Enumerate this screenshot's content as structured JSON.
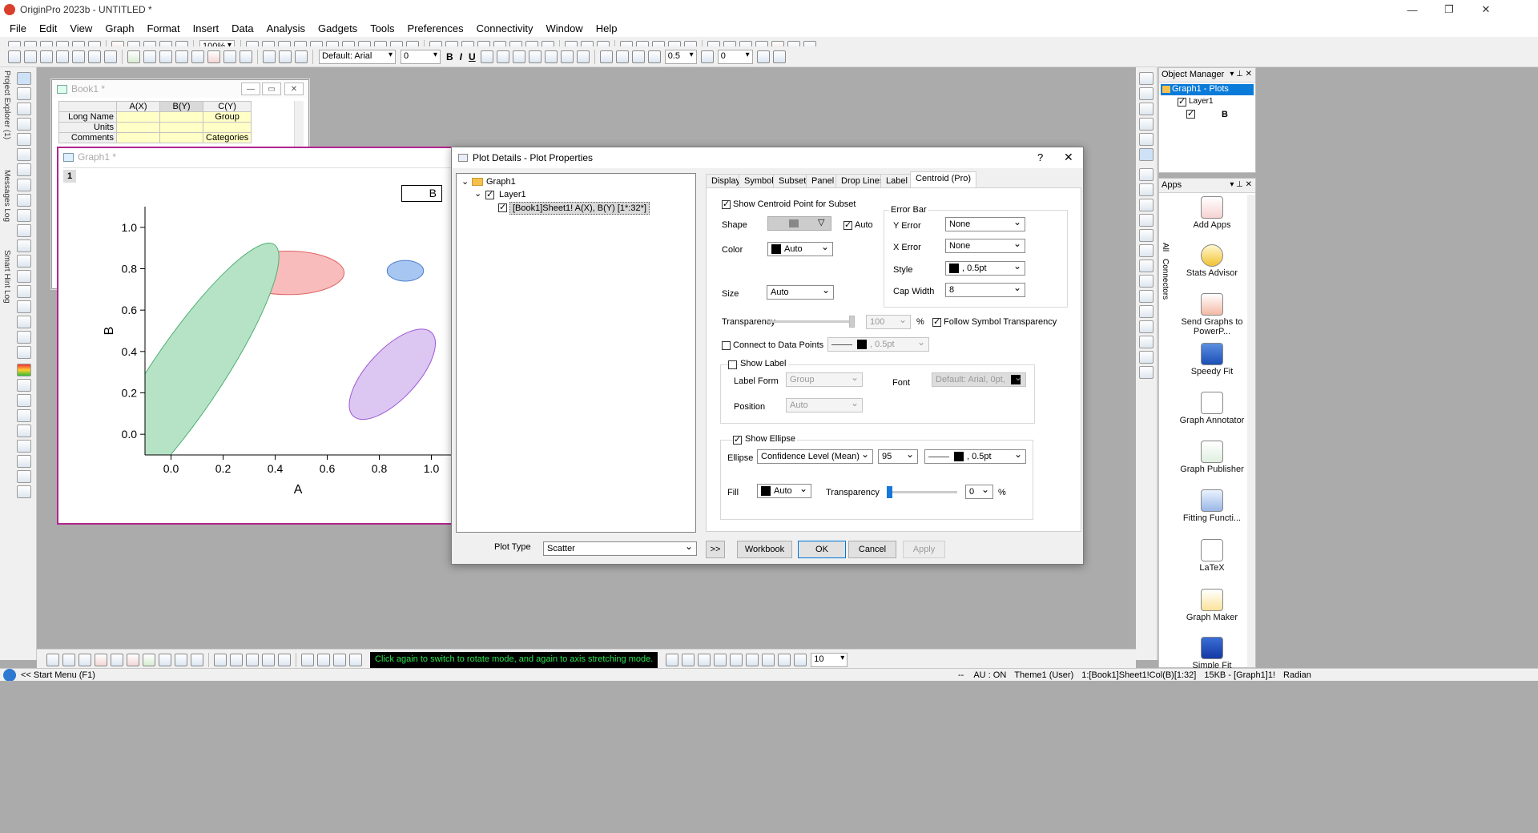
{
  "window": {
    "title": "OriginPro 2023b - UNTITLED *"
  },
  "menu": [
    "File",
    "Edit",
    "View",
    "Graph",
    "Format",
    "Insert",
    "Data",
    "Analysis",
    "Gadgets",
    "Tools",
    "Preferences",
    "Connectivity",
    "Window",
    "Help"
  ],
  "toolbar": {
    "zoom": "100%",
    "font": "Default: Arial",
    "font_size": "0",
    "line_width": "0.5",
    "pattern_size": "0"
  },
  "left_dock": {
    "tabs": [
      "Project Explorer (1)",
      "Messages Log",
      "Smart Hint Log"
    ]
  },
  "book1": {
    "title": "Book1 *",
    "columns": [
      "A(X)",
      "B(Y)",
      "C(Y)"
    ],
    "rows": [
      {
        "label": "Long Name",
        "c": "Group"
      },
      {
        "label": "Units",
        "c": ""
      },
      {
        "label": "Comments",
        "c": "Categories"
      }
    ]
  },
  "graph1": {
    "title": "Graph1 *",
    "layer": "1",
    "legend": "B",
    "chart_data": {
      "type": "scatter",
      "xlabel": "A",
      "ylabel": "B",
      "xlim": [
        -0.1,
        1.1
      ],
      "ylim": [
        -0.1,
        1.1
      ],
      "xticks": [
        "0.0",
        "0.2",
        "0.4",
        "0.6",
        "0.8",
        "1.0"
      ],
      "yticks": [
        "0.0",
        "0.2",
        "0.4",
        "0.6",
        "0.8",
        "1.0"
      ],
      "ellipses": [
        {
          "cx": 0.45,
          "cy": 0.78,
          "rx": 0.215,
          "ry": 0.105,
          "angle": 0,
          "fill": "#f8bcbc",
          "stroke": "#e06363"
        },
        {
          "cx": 0.9,
          "cy": 0.79,
          "rx": 0.07,
          "ry": 0.05,
          "angle": 0,
          "fill": "#a7c6f1",
          "stroke": "#4f80cf"
        },
        {
          "cx": 0.85,
          "cy": 0.29,
          "rx": 0.22,
          "ry": 0.12,
          "angle": -47,
          "fill": "#dcc6f2",
          "stroke": "#a05ad6"
        },
        {
          "cx": 0.05,
          "cy": 0.27,
          "rx": 0.62,
          "ry": 0.17,
          "angle": -56,
          "fill": "#b6e3c6",
          "stroke": "#4caf72"
        }
      ]
    }
  },
  "dialog": {
    "title": "Plot Details - Plot Properties",
    "help": "?",
    "tree": {
      "root": "Graph1",
      "layer": "Layer1",
      "plot": "[Book1]Sheet1! A(X), B(Y) [1*:32*]"
    },
    "tabs": [
      "Display",
      "Symbol",
      "Subset",
      "Panel",
      "Drop Lines",
      "Label",
      "Centroid (Pro)"
    ],
    "active_tab": "Centroid (Pro)",
    "centroid": {
      "show_centroid": "Show Centroid Point for Subset",
      "shape_label": "Shape",
      "auto_label": "Auto",
      "color_label": "Color",
      "color_value": "Auto",
      "size_label": "Size",
      "size_value": "Auto",
      "transparency_label": "Transparency",
      "transparency_value": "100",
      "pct": "%",
      "follow": "Follow Symbol Transparency",
      "connect": "Connect to Data Points",
      "connect_line": ", 0.5pt",
      "error_bar": {
        "title": "Error Bar",
        "y_label": "Y Error",
        "y_value": "None",
        "x_label": "X Error",
        "x_value": "None",
        "style_label": "Style",
        "style_value": ", 0.5pt",
        "cap_label": "Cap Width",
        "cap_value": "8"
      },
      "show_label": "Show Label",
      "label_form_label": "Label Form",
      "label_form_value": "Group",
      "font_label": "Font",
      "font_value": "Default: Arial, 0pt,",
      "position_label": "Position",
      "position_value": "Auto",
      "show_ellipse": "Show Ellipse",
      "ellipse_label": "Ellipse",
      "ellipse_value": "Confidence Level (Mean)",
      "ellipse_level": "95",
      "ellipse_line": ", 0.5pt",
      "fill_label": "Fill",
      "fill_value": "Auto",
      "fill_transparency_label": "Transparency",
      "fill_transparency_value": "0",
      "fill_pct": "%"
    },
    "plot_type_label": "Plot Type",
    "plot_type_value": "Scatter",
    "buttons": {
      "more": ">>",
      "workbook": "Workbook",
      "ok": "OK",
      "cancel": "Cancel",
      "apply": "Apply"
    }
  },
  "object_manager": {
    "title": "Object Manager",
    "graph": "Graph1 - Plots",
    "layer": "Layer1",
    "plot": "B"
  },
  "apps": {
    "title": "Apps",
    "side_tabs": [
      "All",
      "Connectors"
    ],
    "items": [
      "Add Apps",
      "Stats Advisor",
      "Send Graphs to PowerP...",
      "Speedy Fit",
      "Graph Annotator",
      "Graph Publisher",
      "Fitting Functi...",
      "LaTeX",
      "Graph Maker",
      "Simple Fit"
    ]
  },
  "hint_text": "Click again to switch to rotate mode, and again to axis stretching mode.",
  "bottom_toolbar": {
    "zoom": "10"
  },
  "status": {
    "start_menu": "<< Start Menu (F1)",
    "dash": "--",
    "au": "AU : ON",
    "theme": "Theme1 (User)",
    "col": "1:[Book1]Sheet1!Col(B)[1:32]",
    "size": "15KB - [Graph1]1!",
    "angle": "Radian"
  }
}
